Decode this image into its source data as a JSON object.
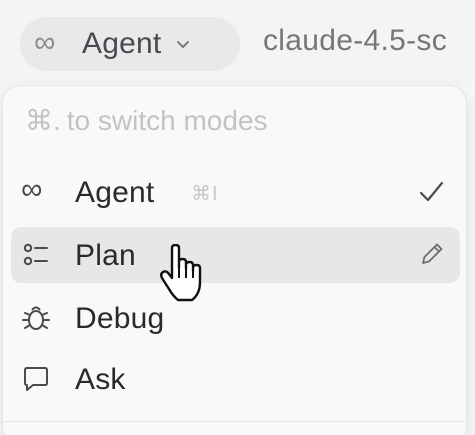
{
  "toolbar": {
    "mode_icon": "infinity-icon",
    "mode_label": "Agent",
    "model_name": "claude-4.5-sc"
  },
  "menu": {
    "hint_key": "⌘.",
    "hint_text": "to switch modes",
    "items": [
      {
        "label": "Agent",
        "icon": "infinity-icon",
        "shortcut": "⌘I",
        "trailing_icon": "check-icon",
        "selected": true
      },
      {
        "label": "Plan",
        "icon": "plan-list-icon",
        "shortcut": "",
        "trailing_icon": "pencil-icon",
        "hovered": true
      },
      {
        "label": "Debug",
        "icon": "bug-icon",
        "shortcut": ""
      },
      {
        "label": "Ask",
        "icon": "chat-bubble-icon",
        "shortcut": ""
      }
    ]
  },
  "colors": {
    "hover_bg": "#e7e7e9",
    "pill_bg": "#e9e9eb",
    "muted_text": "#c3c3c6"
  }
}
